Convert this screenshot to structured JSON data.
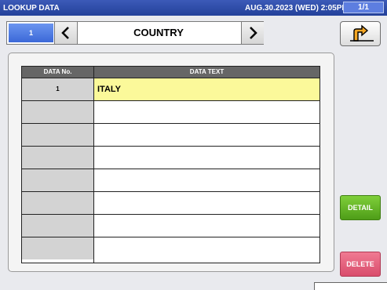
{
  "titlebar": {
    "app_title": "LOOKUP DATA",
    "datetime": "AUG.30.2023 (WED)  2:05PM",
    "page_indicator": "1/1"
  },
  "navigator": {
    "record_number": "1",
    "title": "COUNTRY",
    "prev_icon": "chevron-left-icon",
    "next_icon": "chevron-right-icon"
  },
  "back_icon": "return-arrow-icon",
  "table": {
    "headers": [
      "DATA No.",
      "DATA TEXT"
    ],
    "rows": [
      {
        "no": "1",
        "text": "ITALY"
      },
      {
        "no": "",
        "text": ""
      },
      {
        "no": "",
        "text": ""
      },
      {
        "no": "",
        "text": ""
      },
      {
        "no": "",
        "text": ""
      },
      {
        "no": "",
        "text": ""
      },
      {
        "no": "",
        "text": ""
      },
      {
        "no": "",
        "text": ""
      }
    ]
  },
  "buttons": {
    "detail": "DETAIL",
    "delete": "DELETE"
  },
  "colors": {
    "titlebar": "#23419a",
    "selected_row": "#fbf99a",
    "detail": "#4e9d18",
    "delete": "#d94d6c"
  }
}
